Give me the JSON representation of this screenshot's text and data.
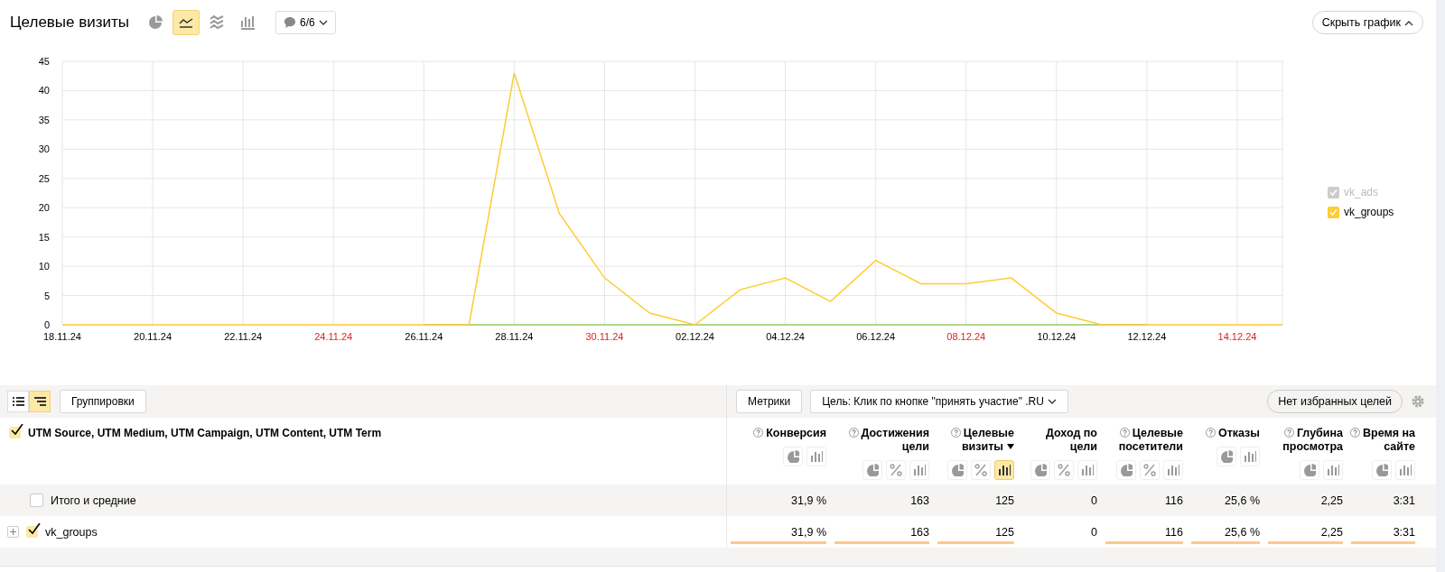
{
  "header": {
    "title": "Целевые визиты",
    "chart_types": [
      {
        "kind": "pie",
        "selected": false
      },
      {
        "kind": "line",
        "selected": true
      },
      {
        "kind": "area",
        "selected": false
      },
      {
        "kind": "bar",
        "selected": false
      }
    ],
    "series_filter": "6/6",
    "hide_button": "Скрыть график"
  },
  "chart": {
    "legend": [
      {
        "checked": false
      },
      {
        "checked": true
      }
    ],
    "weekend_labels": [
      false,
      false,
      false,
      true,
      false,
      false,
      true,
      false,
      false,
      false,
      true,
      false,
      false,
      true
    ],
    "chart_data": {
      "type": "line",
      "categories": [
        "18.11.24",
        null,
        "20.11.24",
        null,
        "22.11.24",
        null,
        "24.11.24",
        null,
        "26.11.24",
        null,
        "28.11.24",
        null,
        "30.11.24",
        null,
        "02.12.24",
        null,
        "04.12.24",
        null,
        "06.12.24",
        null,
        "08.12.24",
        null,
        "10.12.24",
        null,
        "12.12.24",
        null,
        "14.12.24",
        null
      ],
      "series": [
        {
          "name": "vk_ads",
          "color": "#9ccc65",
          "values": [
            null,
            null,
            null,
            null,
            null,
            null,
            null,
            null,
            0,
            0,
            0,
            0,
            0,
            0,
            0,
            0,
            0,
            0,
            0,
            0,
            0,
            0,
            0,
            0,
            0,
            null,
            null,
            null
          ]
        },
        {
          "name": "vk_groups",
          "color": "#ffcc33",
          "values": [
            0,
            0,
            0,
            0,
            0,
            0,
            0,
            0,
            0,
            0,
            43,
            19,
            8,
            2,
            0,
            6,
            8,
            4,
            11,
            7,
            7,
            8,
            2,
            0,
            0,
            0,
            0,
            0
          ]
        }
      ],
      "grid": true,
      "ylim": [
        0,
        45
      ],
      "yticks": [
        0,
        5,
        10,
        15,
        20,
        25,
        30,
        35,
        40,
        45
      ]
    }
  },
  "toolbar": {
    "views": [
      {
        "kind": "list",
        "selected": false
      },
      {
        "kind": "tree",
        "selected": true
      }
    ],
    "groupings_button": "Группировки",
    "metrics_button": "Метрики",
    "goal_dropdown": "Цель: Клик по кнопке \"принять участие\" .RU",
    "favorites_button": "Нет избранных целей"
  },
  "table": {
    "dimension": {
      "label": "UTM Source, UTM Medium, UTM Campaign, UTM Content, UTM Term",
      "checked": true
    },
    "columns": [
      {
        "label": "Конверсия",
        "help": true,
        "sorted": false,
        "views": [
          {
            "kind": "pie",
            "selected": false
          },
          {
            "kind": "bar",
            "selected": false
          }
        ]
      },
      {
        "label": "Достижения цели",
        "help": true,
        "sorted": false,
        "views": [
          {
            "kind": "pie",
            "selected": false
          },
          {
            "kind": "percent",
            "selected": false
          },
          {
            "kind": "bar",
            "selected": false
          }
        ]
      },
      {
        "label": "Целевые визиты",
        "help": true,
        "sorted": true,
        "views": [
          {
            "kind": "pie",
            "selected": false
          },
          {
            "kind": "percent",
            "selected": false
          },
          {
            "kind": "bar",
            "selected": true
          }
        ]
      },
      {
        "label": "Доход по цели",
        "help": false,
        "sorted": false,
        "views": [
          {
            "kind": "pie",
            "selected": false
          },
          {
            "kind": "percent",
            "selected": false
          },
          {
            "kind": "bar",
            "selected": false
          }
        ]
      },
      {
        "label": "Целевые посетители",
        "help": true,
        "sorted": false,
        "views": [
          {
            "kind": "pie",
            "selected": false
          },
          {
            "kind": "percent",
            "selected": false
          },
          {
            "kind": "bar",
            "selected": false
          }
        ]
      },
      {
        "label": "Отказы",
        "help": true,
        "sorted": false,
        "views": [
          {
            "kind": "pie",
            "selected": false
          },
          {
            "kind": "bar",
            "selected": false
          }
        ]
      },
      {
        "label": "Глубина просмотра",
        "help": true,
        "sorted": false,
        "views": [
          {
            "kind": "pie",
            "selected": false
          },
          {
            "kind": "bar",
            "selected": false
          }
        ]
      },
      {
        "label": "Время на сайте",
        "help": true,
        "sorted": false,
        "views": [
          {
            "kind": "pie",
            "selected": false
          },
          {
            "kind": "bar",
            "selected": false
          }
        ]
      }
    ],
    "totals": {
      "label": "Итого и средние",
      "checked": false,
      "values": [
        "31,9 %",
        "163",
        "125",
        "0",
        "116",
        "25,6 %",
        "2,25",
        "3:31"
      ]
    },
    "rows": [
      {
        "label": "vk_groups",
        "checked": true,
        "expandable": true,
        "cells": [
          {
            "value": "31,9 %",
            "bar": true
          },
          {
            "value": "163",
            "bar": true
          },
          {
            "value": "125",
            "bar": true
          },
          {
            "value": "0",
            "bar": false
          },
          {
            "value": "116",
            "bar": true
          },
          {
            "value": "25,6 %",
            "bar": true
          },
          {
            "value": "2,25",
            "bar": true
          },
          {
            "value": "3:31",
            "bar": true
          }
        ]
      }
    ]
  }
}
